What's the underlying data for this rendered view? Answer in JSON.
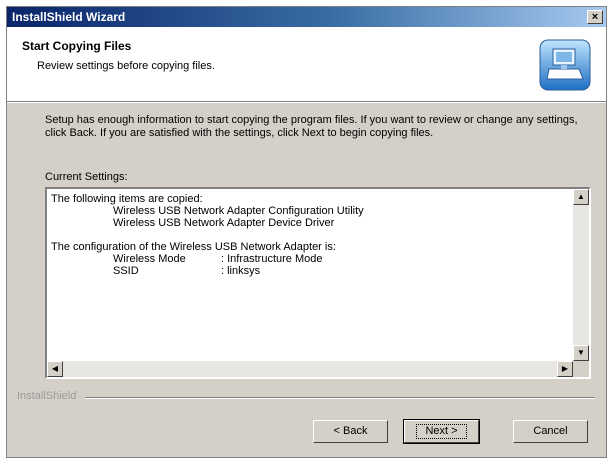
{
  "window": {
    "title": "InstallShield Wizard",
    "close_label": "×"
  },
  "header": {
    "title": "Start Copying Files",
    "subtitle": "Review settings before copying files.",
    "logo_icon": "setup-computer-icon"
  },
  "description": "Setup has enough information to start copying the program files.  If you want to review or change any settings, click Back.  If you are satisfied with the settings, click Next to begin copying files.",
  "current_settings": {
    "label": "Current Settings:",
    "lines": {
      "intro": "The following items are copied:",
      "item1": "Wireless USB Network Adapter Configuration Utility",
      "item2": "Wireless USB Network Adapter Device Driver",
      "config": "The configuration of the Wireless USB Network Adapter is:",
      "mode_key": "Wireless Mode",
      "mode_val": ": Infrastructure Mode",
      "ssid_key": "SSID",
      "ssid_val": ": linksys"
    }
  },
  "footer": {
    "brand": "InstallShield"
  },
  "buttons": {
    "back": "< Back",
    "next": "Next >",
    "cancel": "Cancel"
  }
}
